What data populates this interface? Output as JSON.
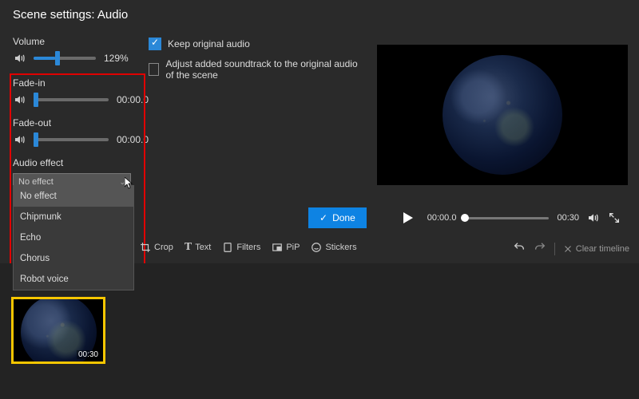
{
  "title": "Scene settings: Audio",
  "volume": {
    "label": "Volume",
    "value": "129%",
    "percent": 35
  },
  "fadeIn": {
    "label": "Fade-in",
    "value": "00:00.0",
    "percent": 0
  },
  "fadeOut": {
    "label": "Fade-out",
    "value": "00:00.0",
    "percent": 0
  },
  "keepOriginal": {
    "label": "Keep original audio",
    "checked": true
  },
  "adjustSoundtrack": {
    "label": "Adjust added soundtrack to the original audio of the scene",
    "checked": false
  },
  "audioEffect": {
    "label": "Audio effect",
    "selected": "No effect",
    "options": [
      "No effect",
      "Chipmunk",
      "Echo",
      "Chorus",
      "Robot voice"
    ]
  },
  "done": "Done",
  "playback": {
    "current": "00:00.0",
    "total": "00:30"
  },
  "tools": {
    "crop": "Crop",
    "text": "Text",
    "filters": "Filters",
    "pip": "PiP",
    "stickers": "Stickers"
  },
  "clearTimeline": "Clear timeline",
  "clipDuration": "00:30"
}
